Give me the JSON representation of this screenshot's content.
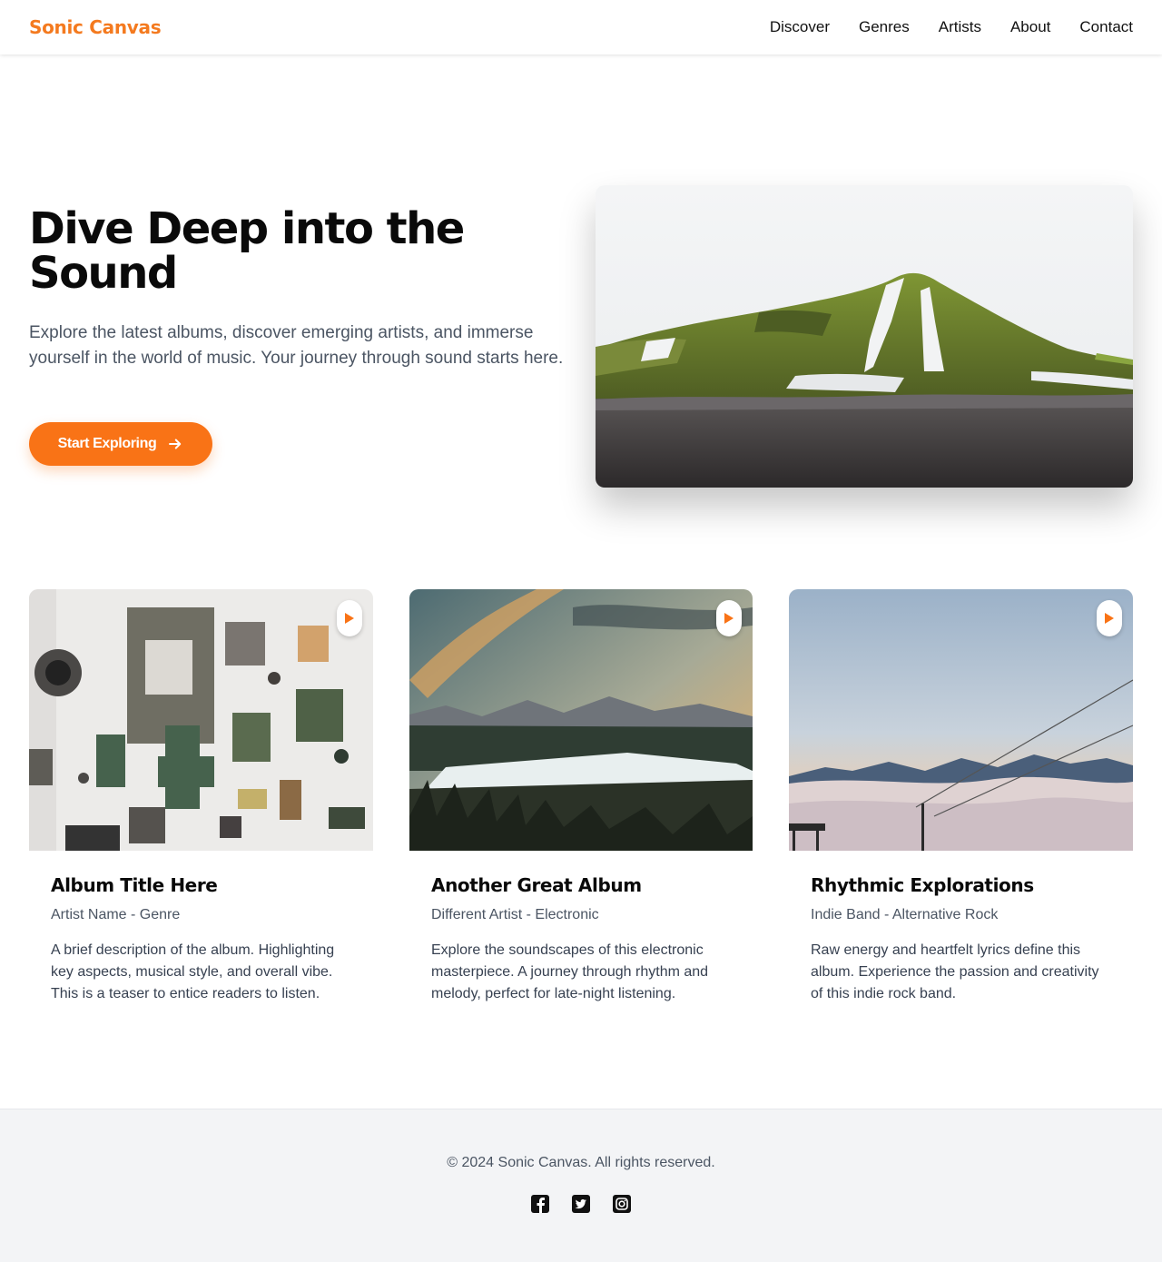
{
  "brand": {
    "name": "Sonic Canvas",
    "color": "#f47a1f"
  },
  "nav": {
    "items": [
      "Discover",
      "Genres",
      "Artists",
      "About",
      "Contact"
    ]
  },
  "hero": {
    "title": "Dive Deep into the Sound",
    "subtitle": "Explore the latest albums, discover emerging artists, and immerse yourself in the world of music. Your journey through sound starts here.",
    "cta_label": "Start Exploring",
    "cta_icon": "arrow-right-icon",
    "accent": "#f97316"
  },
  "albums": [
    {
      "title": "Album Title Here",
      "meta": "Artist Name - Genre",
      "description": "A brief description of the album. Highlighting key aspects, musical style, and overall vibe. This is a teaser to entice readers to listen.",
      "play_icon": "play-icon"
    },
    {
      "title": "Another Great Album",
      "meta": "Different Artist - Electronic",
      "description": "Explore the soundscapes of this electronic masterpiece. A journey through rhythm and melody, perfect for late-night listening.",
      "play_icon": "play-icon"
    },
    {
      "title": "Rhythmic Explorations",
      "meta": "Indie Band - Alternative Rock",
      "description": "Raw energy and heartfelt lyrics define this album. Experience the passion and creativity of this indie rock band.",
      "play_icon": "play-icon"
    }
  ],
  "footer": {
    "copyright": "© 2024 Sonic Canvas. All rights reserved.",
    "socials": [
      "facebook-icon",
      "twitter-icon",
      "instagram-icon"
    ]
  }
}
